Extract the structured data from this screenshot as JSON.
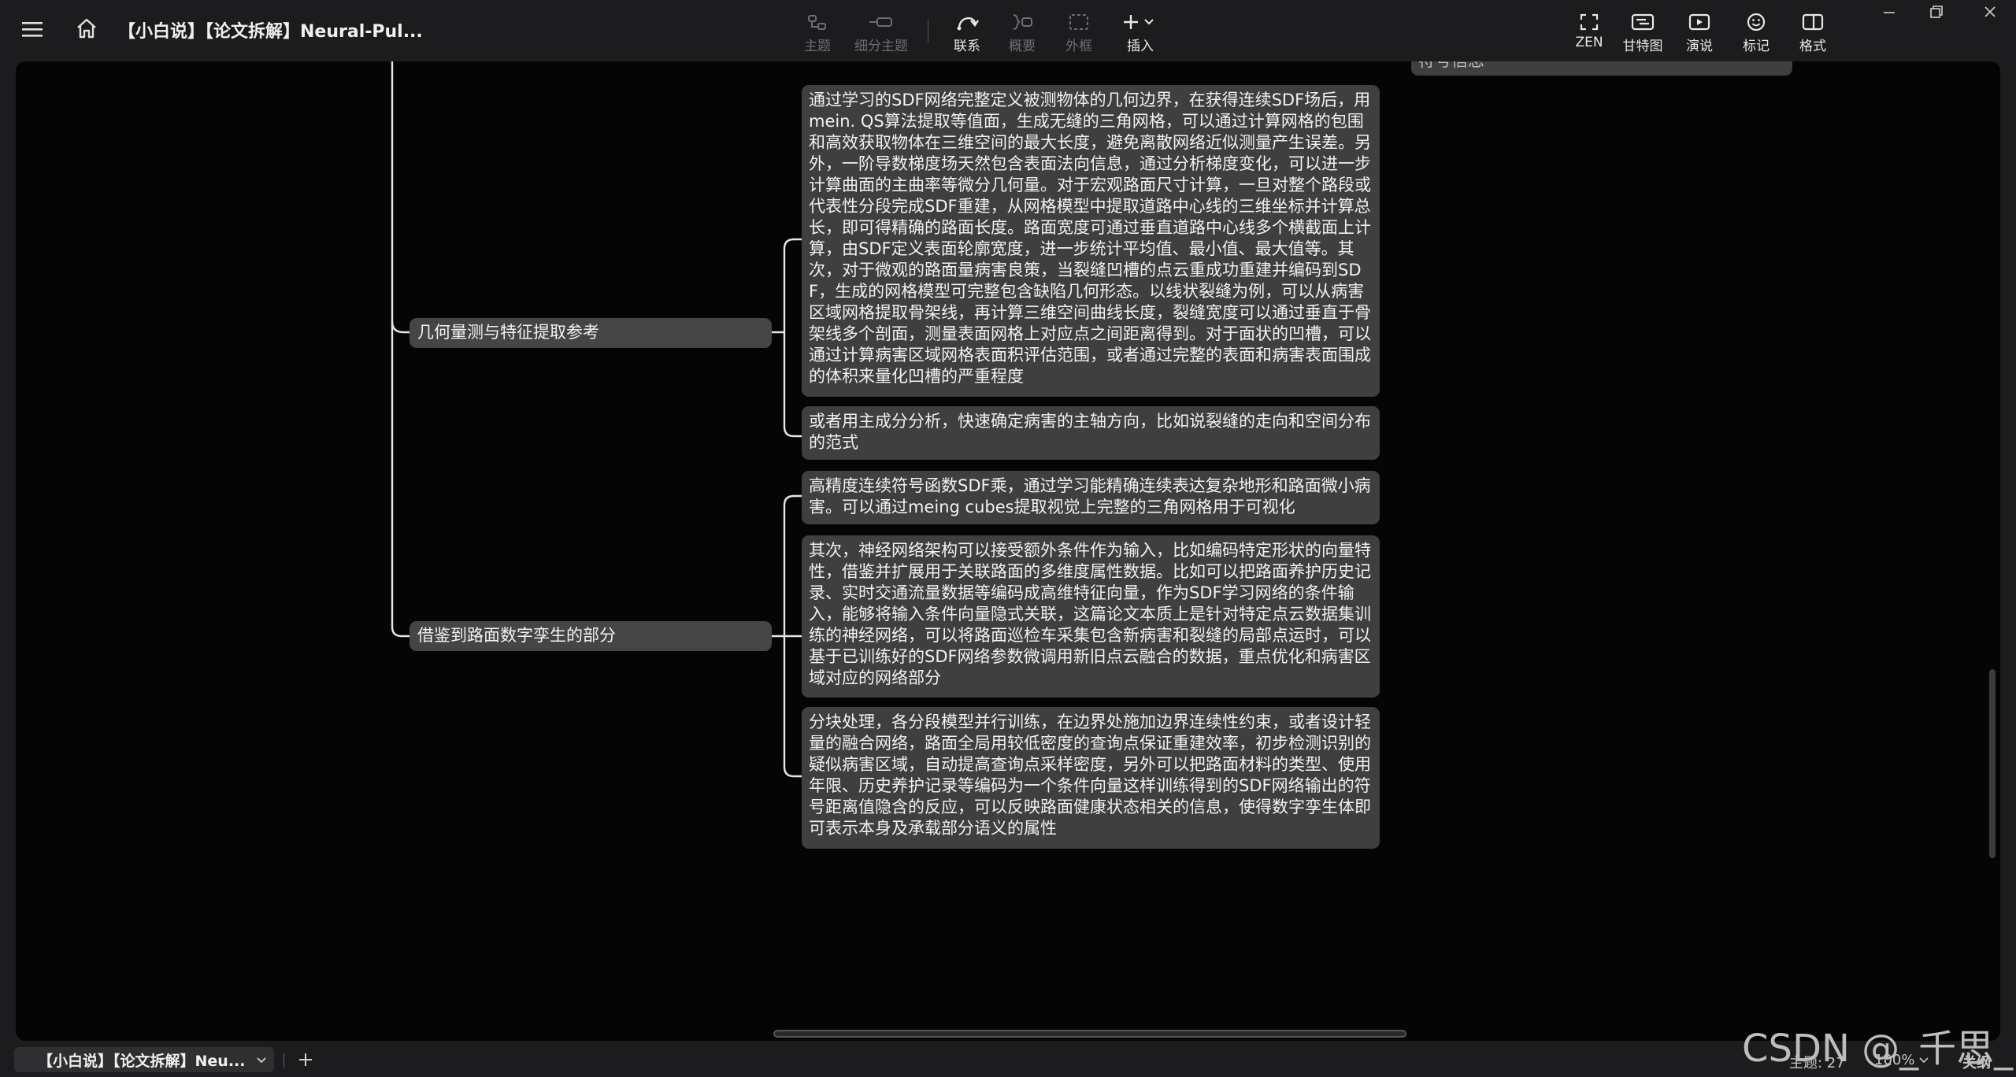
{
  "app": {
    "document_title": "【小白说】【论文拆解】Neural-Pul...",
    "toolbar": {
      "topic": "主题",
      "subtopic": "细分主题",
      "relation": "联系",
      "summary": "概要",
      "boundary": "外框",
      "insert": "插入",
      "zen": "ZEN",
      "gantt": "甘特图",
      "present": "演说",
      "marker": "标记",
      "format": "格式"
    }
  },
  "mindmap": {
    "top_fragment": "符号信息",
    "branches": [
      {
        "label": "几何量测与特征提取参考",
        "children": [
          "通过学习的SDF网络完整定义被测物体的几何边界，在获得连续SDF场后，用mein. QS算法提取等值面，生成无缝的三角网格，可以通过计算网格的包围和高效获取物体在三维空间的最大长度，避免离散网络近似测量产生误差。另外，一阶导数梯度场天然包含表面法向信息，通过分析梯度变化，可以进一步计算曲面的主曲率等微分几何量。对于宏观路面尺寸计算，一旦对整个路段或代表性分段完成SDF重建，从网格模型中提取道路中心线的三维坐标并计算总长，即可得精确的路面长度。路面宽度可通过垂直道路中心线多个横截面上计算，由SDF定义表面轮廓宽度，进一步统计平均值、最小值、最大值等。其次，对于微观的路面量病害良策，当裂缝凹槽的点云重成功重建并编码到SDF，生成的网格模型可完整包含缺陷几何形态。以线状裂缝为例，可以从病害区域网格提取骨架线，再计算三维空间曲线长度，裂缝宽度可以通过垂直于骨架线多个剖面，测量表面网格上对应点之间距离得到。对于面状的凹槽，可以通过计算病害区域网格表面积评估范围，或者通过完整的表面和病害表面围成的体积来量化凹槽的严重程度",
          "或者用主成分分析，快速确定病害的主轴方向，比如说裂缝的走向和空间分布的范式"
        ]
      },
      {
        "label": "借鉴到路面数字孪生的部分",
        "children": [
          "高精度连续符号函数SDF乘，通过学习能精确连续表达复杂地形和路面微小病害。可以通过meing cubes提取视觉上完整的三角网格用于可视化",
          "其次，神经网络架构可以接受额外条件作为输入，比如编码特定形状的向量特性，借鉴并扩展用于关联路面的多维度属性数据。比如可以把路面养护历史记录、实时交通流量数据等编码成高维特征向量，作为SDF学习网络的条件输入，能够将输入条件向量隐式关联，这篇论文本质上是针对特定点云数据集训练的神经网络，可以将路面巡检车采集包含新病害和裂缝的局部点运时，可以基于已训练好的SDF网络参数微调用新旧点云融合的数据，重点优化和病害区域对应的网络部分",
          "分块处理，各分段模型并行训练，在边界处施加边界连续性约束，或者设计轻量的融合网络，路面全局用较低密度的查询点保证重建效率，初步检测识别的疑似病害区域，自动提高查询点采样密度，另外可以把路面材料的类型、使用年限、历史养护记录等编码为一个条件向量这样训练得到的SDF网络输出的符号距离值隐含的反应，可以反映路面健康状态相关的信息，使得数字孪生体即可表示本身及承载部分语义的属性"
        ]
      }
    ]
  },
  "bottom": {
    "tab_label": "【小白说】【论文拆解】Neu...",
    "topic_count": "主题: 27",
    "zoom": "100%",
    "mode": "关纲"
  },
  "watermark": "CSDN @_千思_"
}
